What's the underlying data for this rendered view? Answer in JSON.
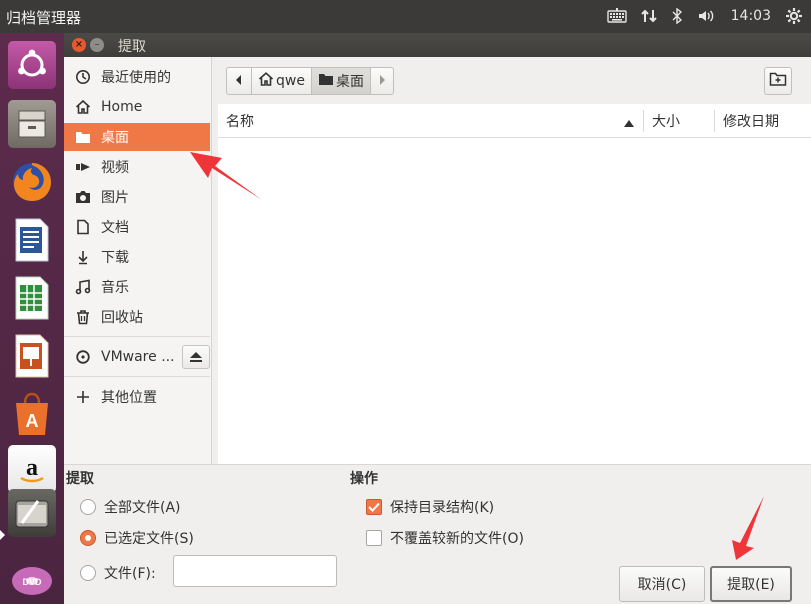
{
  "top_panel": {
    "title": "归档管理器",
    "clock": "14:03"
  },
  "dialog": {
    "title": "提取"
  },
  "sidebar": {
    "items": [
      {
        "label": "最近使用的",
        "icon": "clock-icon"
      },
      {
        "label": "Home",
        "icon": "home-icon"
      },
      {
        "label": "桌面",
        "icon": "folder-icon"
      },
      {
        "label": "视频",
        "icon": "video-icon"
      },
      {
        "label": "图片",
        "icon": "camera-icon"
      },
      {
        "label": "文档",
        "icon": "document-icon"
      },
      {
        "label": "下载",
        "icon": "download-icon"
      },
      {
        "label": "音乐",
        "icon": "music-icon"
      },
      {
        "label": "回收站",
        "icon": "trash-icon"
      }
    ],
    "device": {
      "label": "VMware ...",
      "icon": "disc-icon"
    },
    "other": {
      "label": "其他位置",
      "icon": "plus-icon"
    }
  },
  "pathbar": {
    "home_label": "qwe",
    "current_label": "桌面"
  },
  "filelist": {
    "columns": [
      "名称",
      "大小",
      "修改日期"
    ]
  },
  "extract": {
    "title": "提取",
    "all_files": "全部文件(A)",
    "selected_files": "已选定文件(S)",
    "files_label": "文件(F):",
    "files_value": ""
  },
  "actions_group": {
    "title": "操作",
    "keep_structure": "保持目录结构(K)",
    "keep_structure_checked": true,
    "no_overwrite": "不覆盖较新的文件(O)",
    "no_overwrite_checked": false
  },
  "buttons": {
    "cancel": "取消(C)",
    "extract": "提取(E)"
  },
  "colors": {
    "accent": "#f07746",
    "annotation_arrow": "#f0353a",
    "titlebar": "#3f3e3b",
    "launcher": "#5d2b4c"
  }
}
